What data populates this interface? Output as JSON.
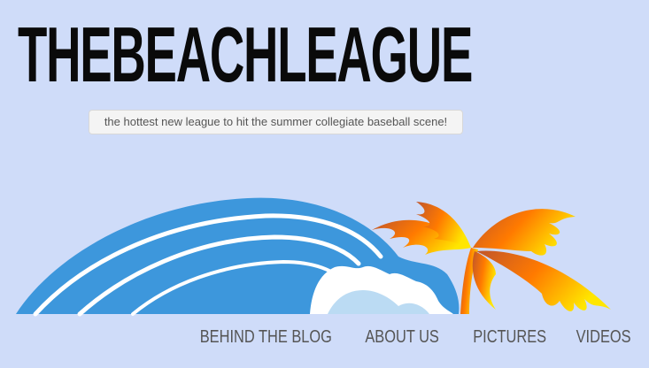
{
  "header": {
    "site_title": "THEBEACHLEAGUE",
    "tagline": "the hottest new league to hit the summer collegiate baseball scene!"
  },
  "logo": {
    "icon": "wave-and-palm-tree-logo",
    "colors": {
      "wave": "#3d97dc",
      "palm_start": "#c0552b",
      "palm_mid": "#ff7a00",
      "palm_end": "#ffe600"
    }
  },
  "nav": {
    "items": [
      {
        "label": "BEHIND THE BLOG"
      },
      {
        "label": "ABOUT US"
      },
      {
        "label": "PICTURES"
      },
      {
        "label": "VIDEOS"
      }
    ]
  }
}
